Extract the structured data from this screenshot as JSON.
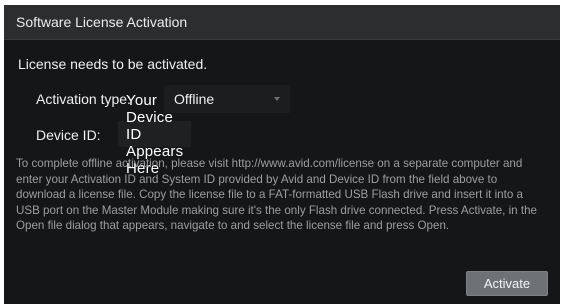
{
  "window": {
    "title": "Software License Activation"
  },
  "status_text": "License needs to be activated.",
  "activation": {
    "label": "Activation type:",
    "selected_value": "Offline"
  },
  "device": {
    "label": "Device ID:",
    "value": "Your Device ID Appears Here"
  },
  "instructions": "To complete offline activation, please visit http://www.avid.com/license on a separate computer and enter your Activation ID and System ID provided by Avid and Device ID from the field above to download a license file. Copy the license file to a FAT-formatted USB Flash drive and insert it into a USB port on the Master Module making sure it's the only Flash drive connected. Press Activate, in the Open file dialog that appears, navigate to and select the license file and press Open.",
  "buttons": {
    "activate_label": "Activate"
  },
  "icons": {
    "dropdown": "chevron-down-icon"
  },
  "colors": {
    "background": "#151617",
    "titlebar": "#2c2d2f",
    "button": "#6e7276",
    "muted_text": "#9c9ea1"
  }
}
